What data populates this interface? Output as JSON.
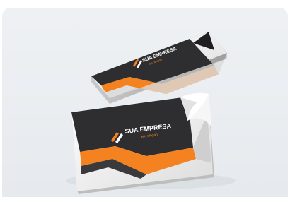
{
  "image": {
    "subject": "business-cards-mockup",
    "background_color": "#ebeff2",
    "colors": {
      "dark": "#2e2e30",
      "orange": "#f58220",
      "white": "#f7f7f5"
    }
  },
  "cards": [
    {
      "company": "SUA EMPRESA",
      "tagline": "seu slogan"
    },
    {
      "company": "SUA EMPRESA",
      "tagline": "seu slogan"
    }
  ]
}
